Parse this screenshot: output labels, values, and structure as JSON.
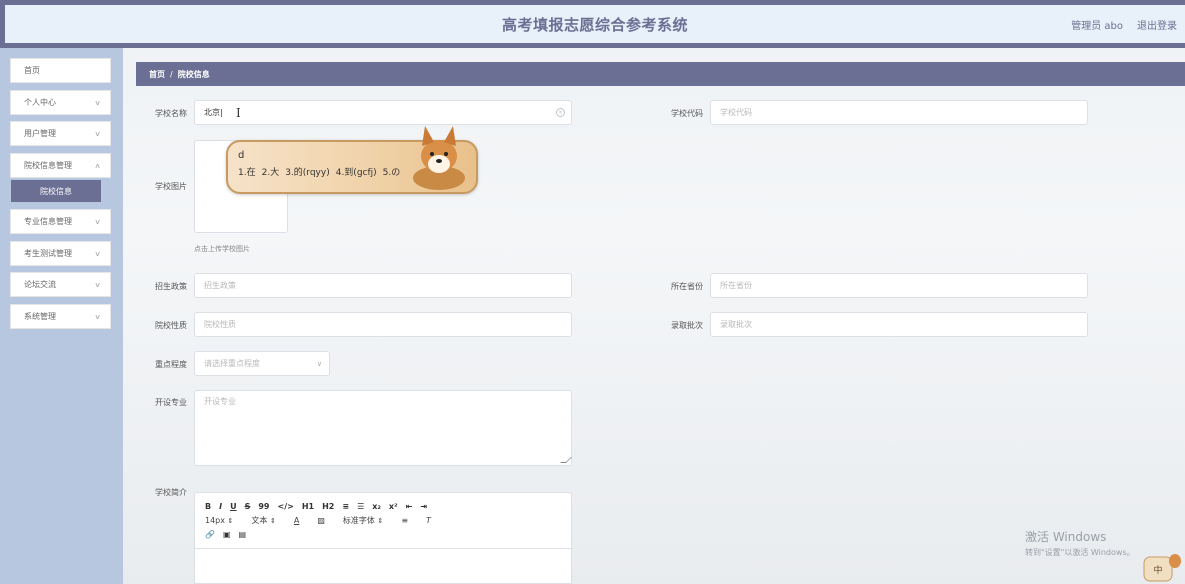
{
  "header": {
    "title": "高考填报志愿综合参考系统",
    "user": "管理员 abo",
    "logout": "退出登录"
  },
  "sidebar": {
    "items": [
      {
        "label": "首页",
        "has_arrow": false
      },
      {
        "label": "个人中心",
        "has_arrow": true
      },
      {
        "label": "用户管理",
        "has_arrow": true
      },
      {
        "label": "院校信息管理",
        "has_arrow": true
      },
      {
        "label": "专业信息管理",
        "has_arrow": true
      },
      {
        "label": "考生测试管理",
        "has_arrow": true
      },
      {
        "label": "论坛交流",
        "has_arrow": true
      },
      {
        "label": "系统管理",
        "has_arrow": true
      }
    ],
    "active_sub": "院校信息"
  },
  "breadcrumb": {
    "home": "首页",
    "sep": "/",
    "current": "院校信息"
  },
  "form": {
    "school_name": {
      "label": "学校名称",
      "value": "北京|"
    },
    "school_code": {
      "label": "学校代码",
      "placeholder": "学校代码"
    },
    "school_image": {
      "label": "学校图片",
      "hint": "点击上传学校图片"
    },
    "admission_policy": {
      "label": "招生政策",
      "placeholder": "招生政策"
    },
    "province": {
      "label": "所在省份",
      "placeholder": "所在省份"
    },
    "school_type": {
      "label": "院校性质",
      "placeholder": "院校性质"
    },
    "batch": {
      "label": "录取批次",
      "placeholder": "录取批次"
    },
    "key_level": {
      "label": "重点程度",
      "placeholder": "请选择重点程度"
    },
    "majors": {
      "label": "开设专业",
      "placeholder": "开设专业"
    },
    "intro": {
      "label": "学校简介"
    }
  },
  "editor": {
    "row1": [
      "B",
      "I",
      "U",
      "S",
      "99",
      "</>",
      "H1",
      "H2",
      "≡",
      "☰",
      "x₂",
      "x²",
      "⇤",
      "⇥"
    ],
    "font_size": "14px",
    "format": "文本",
    "font_family": "标准字体",
    "row3": [
      "🔗",
      "▣",
      "▤"
    ]
  },
  "ime": {
    "composition": "d",
    "candidates": [
      "1.在",
      "2.大",
      "3.的(rqyy)",
      "4.到(gcfj)",
      "5.の"
    ]
  },
  "watermark": {
    "title": "激活 Windows",
    "sub": "转到\"设置\"以激活 Windows。"
  },
  "colors": {
    "accent": "#6b6f93",
    "sidebar": "#b7c7e0",
    "header_bg": "#e8f1fa"
  }
}
